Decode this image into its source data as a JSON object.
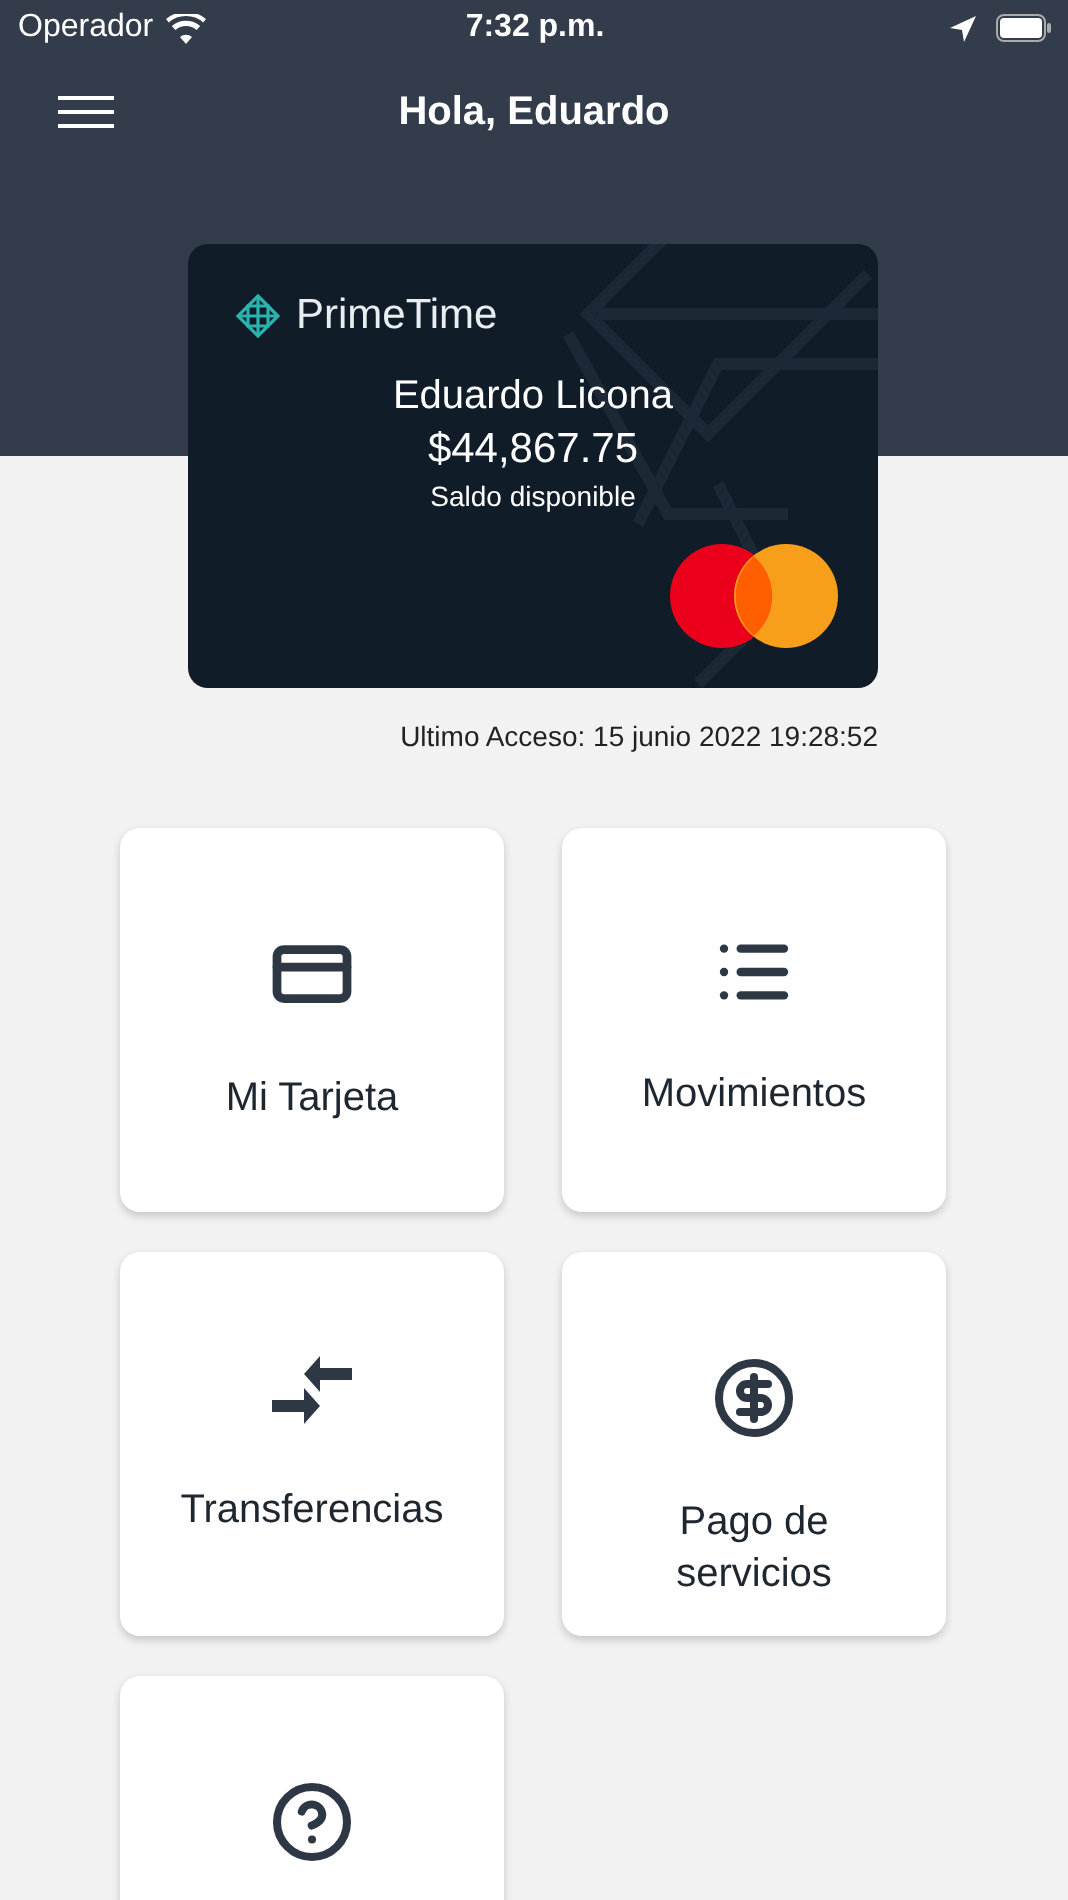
{
  "status_bar": {
    "carrier": "Operador",
    "time": "7:32 p.m."
  },
  "header": {
    "title": "Hola, Eduardo"
  },
  "card": {
    "brand": "PrimeTime",
    "holder": "Eduardo Licona",
    "balance": "$44,867.75",
    "balance_label": "Saldo disponible"
  },
  "last_access": "Ultimo Acceso: 15 junio 2022 19:28:52",
  "tiles": [
    {
      "kind": "full",
      "label": "Mi Tarjeta"
    },
    {
      "kind": "full",
      "label": "Movimientos"
    },
    {
      "kind": "full",
      "label": "Transferencias"
    },
    {
      "kind": "full",
      "label": "Pago de servicios"
    },
    {
      "kind": "cut"
    }
  ]
}
